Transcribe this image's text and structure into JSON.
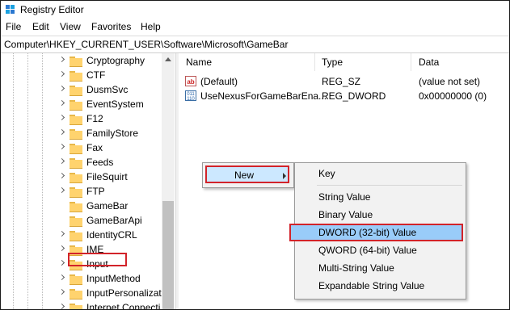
{
  "window": {
    "title": "Registry Editor",
    "icon": "registry-icon"
  },
  "menu": [
    "File",
    "Edit",
    "View",
    "Favorites",
    "Help"
  ],
  "address": "Computer\\HKEY_CURRENT_USER\\Software\\Microsoft\\GameBar",
  "tree": {
    "items": [
      "Cryptography",
      "CTF",
      "DusmSvc",
      "EventSystem",
      "F12",
      "FamilyStore",
      "Fax",
      "Feeds",
      "FileSquirt",
      "FTP",
      "GameBar",
      "GameBarApi",
      "IdentityCRL",
      "IME",
      "Input",
      "InputMethod",
      "InputPersonalizat",
      "Internet Connecti"
    ],
    "selected": "GameBar"
  },
  "list": {
    "columns": [
      "Name",
      "Type",
      "Data"
    ],
    "rows": [
      {
        "name": "(Default)",
        "type": "REG_SZ",
        "data": "(value not set)",
        "icon": "string-value-icon"
      },
      {
        "name": "UseNexusForGameBarEna...",
        "type": "REG_DWORD",
        "data": "0x00000000 (0)",
        "icon": "binary-value-icon"
      }
    ]
  },
  "context_menu": {
    "new_label": "New",
    "submenu": {
      "key": "Key",
      "items": [
        "String Value",
        "Binary Value",
        "DWORD (32-bit) Value",
        "QWORD (64-bit) Value",
        "Multi-String Value",
        "Expandable String Value"
      ],
      "highlighted": "DWORD (32-bit) Value"
    }
  },
  "colors": {
    "highlight_border": "#d2232a",
    "menu_hover": "#cce8ff",
    "folder": "#ffd36e"
  }
}
